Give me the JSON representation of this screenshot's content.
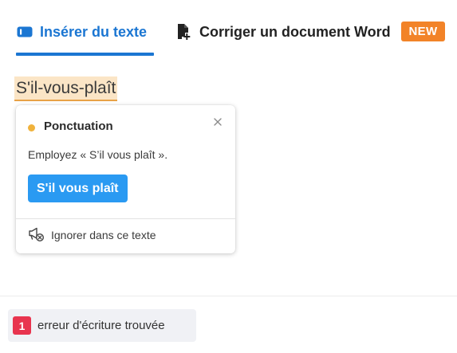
{
  "tabs": {
    "insert_label": "Insérer du texte",
    "word_label": "Corriger un document Word",
    "new_badge": "NEW",
    "active_color": "#1b76d2"
  },
  "editor": {
    "error_word": "S'il-vous-plaît"
  },
  "popup": {
    "category": "Ponctuation",
    "category_color": "#f0b23c",
    "message": "Employez « S’il vous plaît ».",
    "suggestion": "S'il vous plaît",
    "ignore_label": "Ignorer dans ce texte",
    "icons": {
      "close": "close-icon",
      "ignore": "megaphone-mute-icon"
    }
  },
  "footer": {
    "error_count": "1",
    "error_label": "erreur d'écriture trouvée",
    "badge_color": "#e8344e"
  }
}
